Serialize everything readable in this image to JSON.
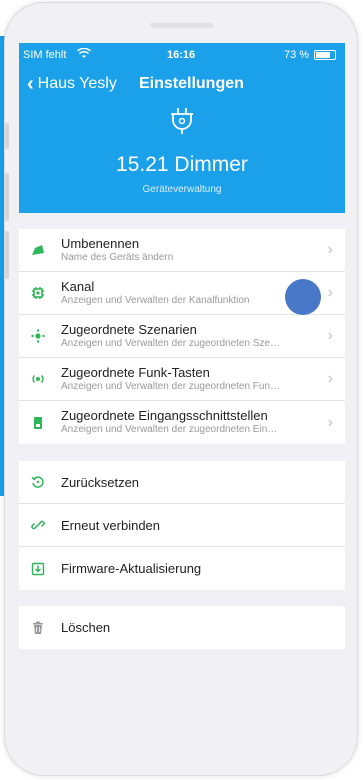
{
  "status_bar": {
    "carrier": "SIM fehlt",
    "time": "16:16",
    "battery": "73 %"
  },
  "nav": {
    "back_label": "Haus Yesly",
    "title": "Einstellungen"
  },
  "device": {
    "name": "15.21 Dimmer",
    "subtitle": "Geräteverwaltung"
  },
  "settings": [
    {
      "label": "Umbenennen",
      "sub": "Name des Geräts ändern",
      "icon": "rename-icon"
    },
    {
      "label": "Kanal",
      "sub": "Anzeigen und Verwalten der Kanalfunktion",
      "icon": "channel-icon"
    },
    {
      "label": "Zugeordnete Szenarien",
      "sub": "Anzeigen und Verwalten der zugeordneten Sze…",
      "icon": "scenarios-icon"
    },
    {
      "label": "Zugeordnete Funk-Tasten",
      "sub": "Anzeigen und Verwalten der zugeordneten Fun…",
      "icon": "radio-button-icon"
    },
    {
      "label": "Zugeordnete Eingangsschnittstellen",
      "sub": "Anzeigen und Verwalten der zugeordneten Ein…",
      "icon": "input-interface-icon"
    }
  ],
  "actions": [
    {
      "label": "Zurücksetzen",
      "icon": "reset-icon"
    },
    {
      "label": "Erneut verbinden",
      "icon": "reconnect-icon"
    },
    {
      "label": "Firmware-Aktualisierung",
      "icon": "firmware-update-icon"
    }
  ],
  "danger": [
    {
      "label": "Löschen",
      "icon": "trash-icon"
    }
  ],
  "colors": {
    "accent": "#1ba0ea",
    "green": "#2fb65a",
    "grey_icon": "#9a9a9f",
    "touch": "#4a78c8"
  }
}
